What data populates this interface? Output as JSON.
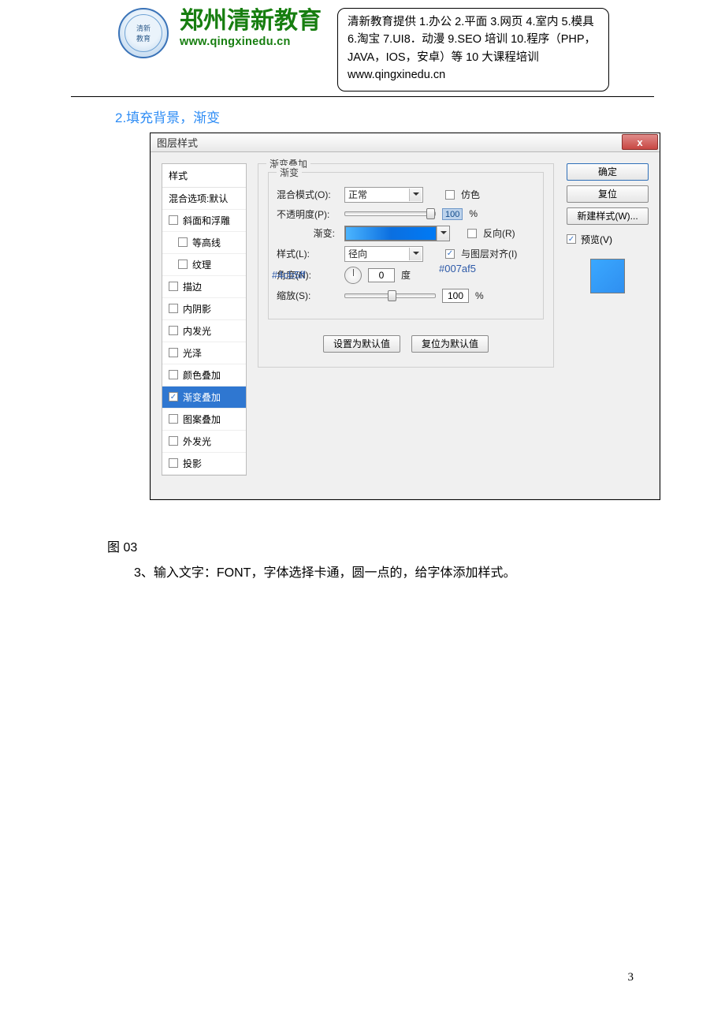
{
  "header": {
    "brand_cn": "郑州清新教育",
    "brand_en": "www.qingxinedu.cn",
    "info": "清新教育提供 1.办公 2.平面 3.网页 4.室内 5.模具 6.淘宝 7.UI8．动漫 9.SEO 培训 10.程序（PHP，JAVA，IOS，安卓）等 10 大课程培训  www.qingxinedu.cn"
  },
  "section_heading": "2.填充背景，渐变",
  "dialog": {
    "title": "图层样式",
    "close_label": "x",
    "styles_list": {
      "header": "样式",
      "blend_opts": "混合选项:默认",
      "items": [
        {
          "label": "斜面和浮雕",
          "indent": false,
          "checked": false
        },
        {
          "label": "等高线",
          "indent": true,
          "checked": false
        },
        {
          "label": "纹理",
          "indent": true,
          "checked": false
        },
        {
          "label": "描边",
          "indent": false,
          "checked": false
        },
        {
          "label": "内阴影",
          "indent": false,
          "checked": false
        },
        {
          "label": "内发光",
          "indent": false,
          "checked": false
        },
        {
          "label": "光泽",
          "indent": false,
          "checked": false
        },
        {
          "label": "颜色叠加",
          "indent": false,
          "checked": false
        },
        {
          "label": "渐变叠加",
          "indent": false,
          "checked": true,
          "selected": true
        },
        {
          "label": "图案叠加",
          "indent": false,
          "checked": false
        },
        {
          "label": "外发光",
          "indent": false,
          "checked": false
        },
        {
          "label": "投影",
          "indent": false,
          "checked": false
        }
      ]
    },
    "panel": {
      "group_title": "渐变叠加",
      "inner_title": "渐变",
      "blend_mode_label": "混合模式(O):",
      "blend_mode_value": "正常",
      "dither_label": "仿色",
      "opacity_label": "不透明度(P):",
      "opacity_value": "100",
      "percent": "%",
      "gradient_label": "渐变:",
      "reverse_label": "反向(R)",
      "style_label": "样式(L):",
      "style_value": "径向",
      "align_label": "与图层对齐(I)",
      "angle_label": "角度(N):",
      "angle_value": "0",
      "angle_unit": "度",
      "scale_label": "缩放(S):",
      "scale_value": "100",
      "hex_left": "#4cb5ff",
      "hex_right": "#007af5",
      "set_default": "设置为默认值",
      "reset_default": "复位为默认值"
    },
    "buttons": {
      "ok": "确定",
      "reset": "复位",
      "new_style": "新建样式(W)...",
      "preview": "预览(V)"
    }
  },
  "caption": "图 03",
  "step3": "3、输入文字：FONT，字体选择卡通，圆一点的，给字体添加样式。",
  "page_number": "3"
}
